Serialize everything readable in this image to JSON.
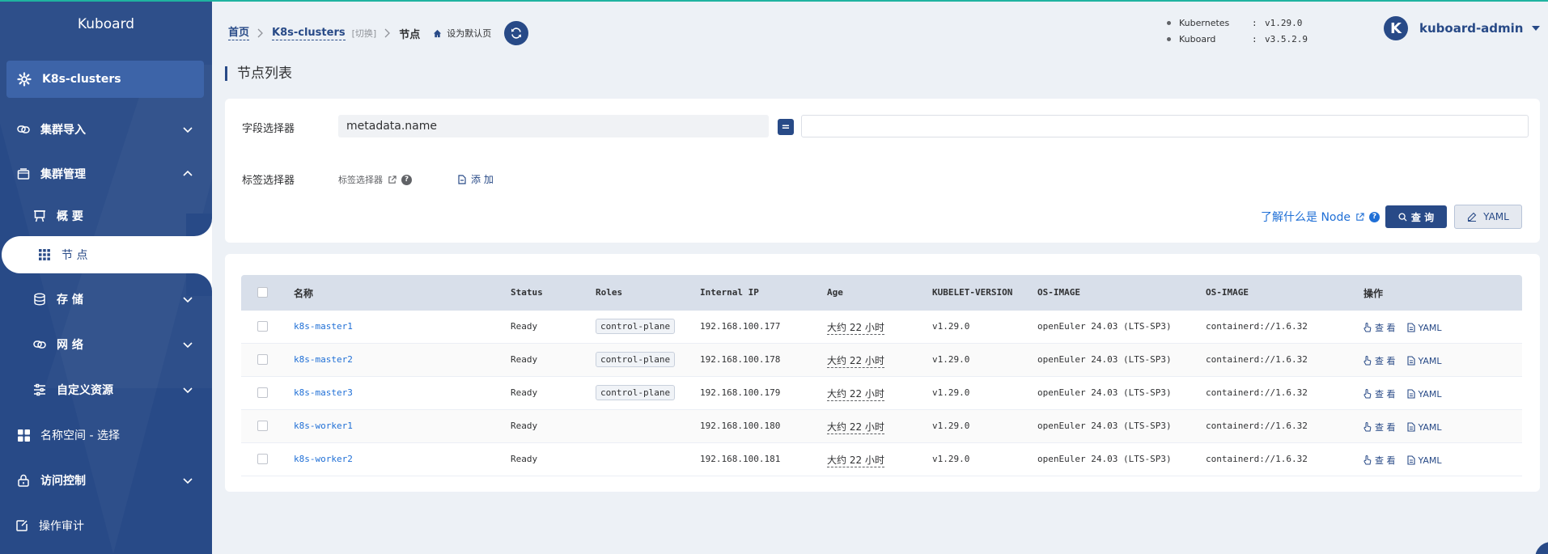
{
  "brand": "Kuboard",
  "sidebar": {
    "cluster": "K8s-clusters",
    "items": [
      {
        "label": "集群导入"
      },
      {
        "label": "集群管理"
      },
      {
        "label": "概 要"
      },
      {
        "label": "节 点"
      },
      {
        "label": "存 储"
      },
      {
        "label": "网 络"
      },
      {
        "label": "自定义资源"
      },
      {
        "label": "名称空间 - 选择"
      },
      {
        "label": "访问控制"
      },
      {
        "label": "操作审计"
      }
    ]
  },
  "breadcrumb": {
    "home": "首页",
    "cluster": "K8s-clusters",
    "switch": "[切换]",
    "current": "节点",
    "set_default": "设为默认页"
  },
  "versions": {
    "kubernetes_label": "Kubernetes",
    "kubernetes_value": "v1.29.0",
    "kuboard_label": "Kuboard",
    "kuboard_value": "v3.5.2.9",
    "colon": ":"
  },
  "user": {
    "avatar_letter": "K",
    "name": "kuboard-admin"
  },
  "page_title": "节点列表",
  "filter": {
    "field_label": "字段选择器",
    "field_value": "metadata.name",
    "eq": "=",
    "value_input": "",
    "label_label": "标签选择器",
    "label_selector_link": "标签选择器",
    "add": "添 加",
    "learn": "了解什么是 Node",
    "query": "查 询",
    "yaml": "YAML"
  },
  "table": {
    "headers": [
      "名称",
      "Status",
      "Roles",
      "Internal IP",
      "Age",
      "KUBELET-VERSION",
      "OS-IMAGE",
      "OS-IMAGE",
      "操作"
    ],
    "rows": [
      {
        "name": "k8s-master1",
        "status": "Ready",
        "role": "control-plane",
        "ip": "192.168.100.177",
        "age": "大约 22 小时",
        "kubelet": "v1.29.0",
        "os": "openEuler 24.03 (LTS-SP3)",
        "runtime": "containerd://1.6.32"
      },
      {
        "name": "k8s-master2",
        "status": "Ready",
        "role": "control-plane",
        "ip": "192.168.100.178",
        "age": "大约 22 小时",
        "kubelet": "v1.29.0",
        "os": "openEuler 24.03 (LTS-SP3)",
        "runtime": "containerd://1.6.32"
      },
      {
        "name": "k8s-master3",
        "status": "Ready",
        "role": "control-plane",
        "ip": "192.168.100.179",
        "age": "大约 22 小时",
        "kubelet": "v1.29.0",
        "os": "openEuler 24.03 (LTS-SP3)",
        "runtime": "containerd://1.6.32"
      },
      {
        "name": "k8s-worker1",
        "status": "Ready",
        "role": "",
        "ip": "192.168.100.180",
        "age": "大约 22 小时",
        "kubelet": "v1.29.0",
        "os": "openEuler 24.03 (LTS-SP3)",
        "runtime": "containerd://1.6.32"
      },
      {
        "name": "k8s-worker2",
        "status": "Ready",
        "role": "",
        "ip": "192.168.100.181",
        "age": "大约 22 小时",
        "kubelet": "v1.29.0",
        "os": "openEuler 24.03 (LTS-SP3)",
        "runtime": "containerd://1.6.32"
      }
    ],
    "op_view": "查 看",
    "op_yaml": "YAML"
  },
  "colors": {
    "primary": "#284a87",
    "accent": "#1fb3a0",
    "link": "#1f6fd6"
  }
}
